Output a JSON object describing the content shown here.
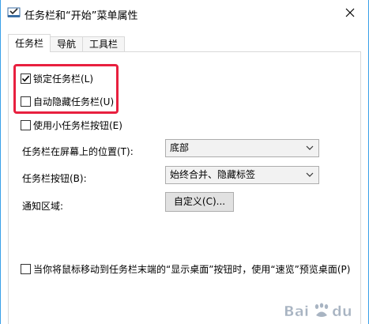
{
  "window": {
    "title": "任务栏和“开始”菜单属性"
  },
  "icons": {
    "app": "taskbar-properties-icon",
    "close": "close-icon",
    "dropdown": "chevron-down-icon",
    "check": "checkmark-icon"
  },
  "tabs": [
    {
      "label": "任务栏",
      "active": true
    },
    {
      "label": "导航",
      "active": false
    },
    {
      "label": "工具栏",
      "active": false
    }
  ],
  "options": {
    "lock_taskbar": {
      "label": "锁定任务栏(L)",
      "checked": true
    },
    "auto_hide": {
      "label": "自动隐藏任务栏(U)",
      "checked": false
    },
    "small_buttons": {
      "label": "使用小任务栏按钮(E)",
      "checked": false
    },
    "peek": {
      "label": "当你将鼠标移动到任务栏末端的“显示桌面”按钮时，使用“速览”预览桌面(P)",
      "checked": false
    }
  },
  "position": {
    "label": "任务栏在屏幕上的位置(T):",
    "value": "底部"
  },
  "buttons_combine": {
    "label": "任务栏按钮(B):",
    "value": "始终合并、隐藏标签"
  },
  "notification": {
    "label": "通知区域:",
    "button": "自定义(C)..."
  },
  "colors": {
    "highlight": "#e8203f",
    "window_border": "#3aa0e8",
    "button_face": "#e1e1e1"
  },
  "watermark": {
    "text": "Bai du"
  }
}
